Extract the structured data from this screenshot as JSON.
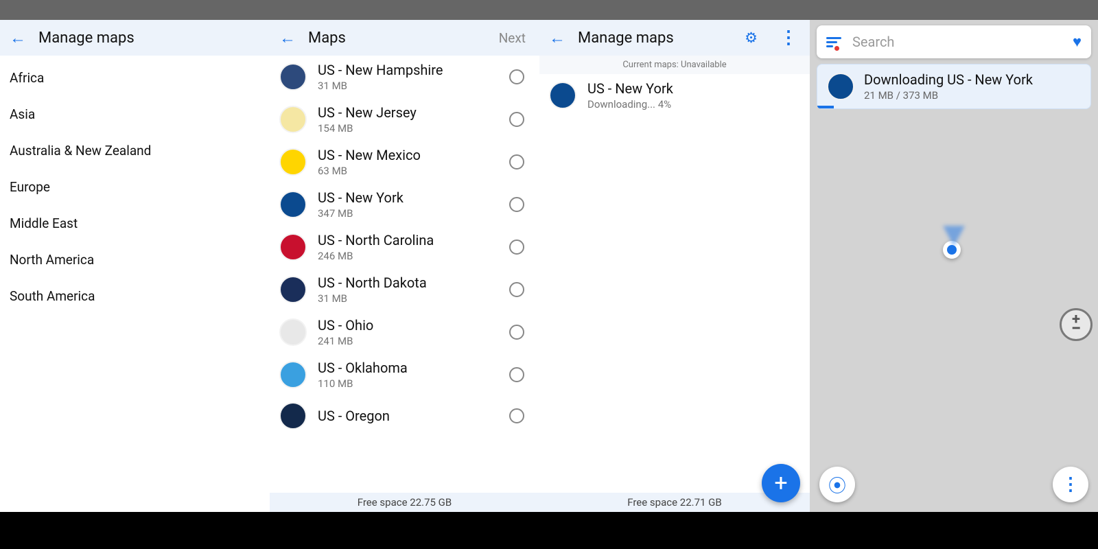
{
  "pane1": {
    "title": "Manage maps",
    "regions": [
      "Africa",
      "Asia",
      "Australia & New Zealand",
      "Europe",
      "Middle East",
      "North America",
      "South America"
    ]
  },
  "pane2": {
    "title": "Maps",
    "next": "Next",
    "footer": "Free space 22.75 GB",
    "items": [
      {
        "name": "US - New Hampshire",
        "size": "31 MB",
        "bg": "#2d4a7c"
      },
      {
        "name": "US - New Jersey",
        "size": "154 MB",
        "bg": "#f5e7a3"
      },
      {
        "name": "US - New Mexico",
        "size": "63 MB",
        "bg": "#ffd500"
      },
      {
        "name": "US - New York",
        "size": "347 MB",
        "bg": "#0b4a8f"
      },
      {
        "name": "US - North Carolina",
        "size": "246 MB",
        "bg": "#c8102e"
      },
      {
        "name": "US - North Dakota",
        "size": "31 MB",
        "bg": "#1a2e5a"
      },
      {
        "name": "US - Ohio",
        "size": "241 MB",
        "bg": "#e8e8e8"
      },
      {
        "name": "US - Oklahoma",
        "size": "110 MB",
        "bg": "#3aa0e0"
      },
      {
        "name": "US - Oregon",
        "size": "",
        "bg": "#13294b"
      }
    ]
  },
  "pane3": {
    "title": "Manage maps",
    "banner": "Current maps: Unavailable",
    "download": {
      "name": "US - New York",
      "status": "Downloading... 4%",
      "bg": "#0b4a8f"
    },
    "footer": "Free space 22.71 GB"
  },
  "pane4": {
    "search_placeholder": "Search",
    "card": {
      "title": "Downloading US - New York",
      "size": "21 MB / 373 MB",
      "bg": "#0b4a8f"
    }
  }
}
